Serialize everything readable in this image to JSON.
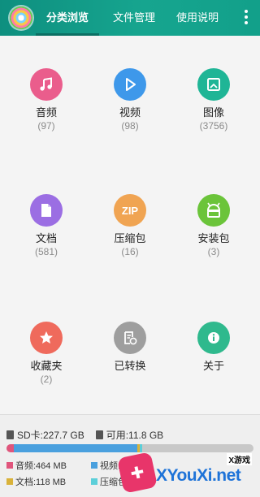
{
  "colors": {
    "accent": "#16a58f",
    "music": "#ea5d8c",
    "video": "#3e98ea",
    "image": "#1fb596",
    "doc": "#9b6ee3",
    "zip": "#f0a452",
    "apk": "#6bc43a",
    "fav": "#ef6a5c",
    "transfer": "#9e9e9e",
    "about": "#2fb98d"
  },
  "tabs": [
    {
      "label": "分类浏览"
    },
    {
      "label": "文件管理"
    },
    {
      "label": "使用说明"
    }
  ],
  "categories": [
    {
      "label": "音频",
      "count": "(97)",
      "icon": "music-icon"
    },
    {
      "label": "视频",
      "count": "(98)",
      "icon": "play-icon"
    },
    {
      "label": "图像",
      "count": "(3756)",
      "icon": "image-icon"
    },
    {
      "label": "文档",
      "count": "(581)",
      "icon": "document-icon"
    },
    {
      "label": "压缩包",
      "count": "(16)",
      "icon": "zip-icon",
      "badge": "ZIP"
    },
    {
      "label": "安装包",
      "count": "(3)",
      "icon": "android-icon"
    },
    {
      "label": "收藏夹",
      "count": "(2)",
      "icon": "star-icon"
    },
    {
      "label": "已转换",
      "count": "",
      "icon": "convert-icon"
    },
    {
      "label": "关于",
      "count": "",
      "icon": "info-icon"
    }
  ],
  "storage": {
    "sd_total": "SD卡:227.7 GB",
    "available": "可用:11.8 GB",
    "segments": [
      {
        "name": "音频",
        "color": "#e0557c",
        "fraction": 0.03
      },
      {
        "name": "视频",
        "color": "#4aa0de",
        "fraction": 0.5
      },
      {
        "name": "文档",
        "color": "#d9b23a",
        "fraction": 0.01
      },
      {
        "name": "压缩包",
        "color": "#5ccfd9",
        "fraction": 0.01
      }
    ],
    "legend": [
      {
        "text": "音频:464 MB",
        "color": "#e0557c"
      },
      {
        "text": "视频:1",
        "color": "#4aa0de"
      },
      {
        "text": "文档:118 MB",
        "color": "#d9b23a"
      },
      {
        "text": "压缩包",
        "color": "#5ccfd9"
      }
    ]
  },
  "watermark": {
    "text": "XYouXi.net",
    "tag": "X游戏"
  }
}
